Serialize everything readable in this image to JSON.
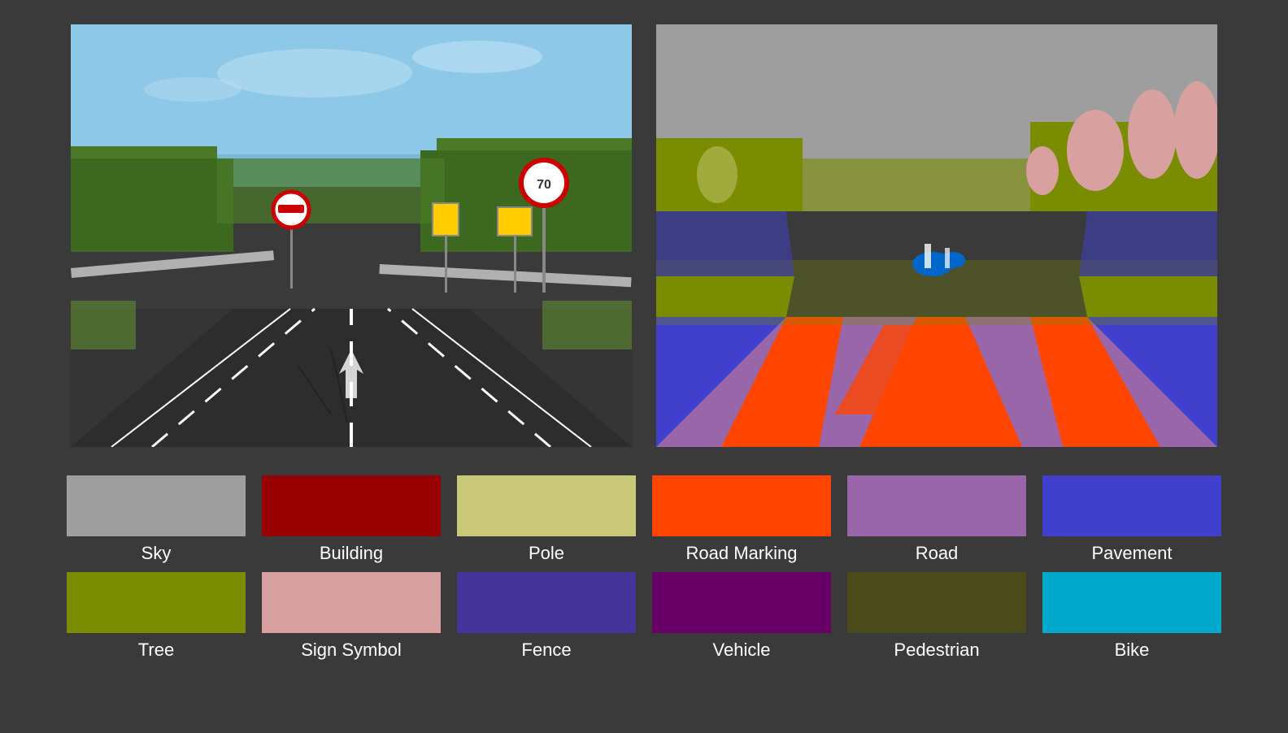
{
  "images": {
    "left_alt": "Road scene - original photo",
    "right_alt": "Road scene - semantic segmentation"
  },
  "legend": {
    "row1": [
      {
        "label": "Sky",
        "color": "#9e9e9e"
      },
      {
        "label": "Building",
        "color": "#990000"
      },
      {
        "label": "Pole",
        "color": "#c8c878"
      },
      {
        "label": "Road Marking",
        "color": "#ff4500"
      },
      {
        "label": "Road",
        "color": "#9966aa"
      },
      {
        "label": "Pavement",
        "color": "#4040cc"
      }
    ],
    "row2": [
      {
        "label": "Tree",
        "color": "#7a8c00"
      },
      {
        "label": "Sign Symbol",
        "color": "#d9a0a0"
      },
      {
        "label": "Fence",
        "color": "#443399"
      },
      {
        "label": "Vehicle",
        "color": "#660066"
      },
      {
        "label": "Pedestrian",
        "color": "#4a4a1a"
      },
      {
        "label": "Bike",
        "color": "#00aacc"
      }
    ]
  }
}
